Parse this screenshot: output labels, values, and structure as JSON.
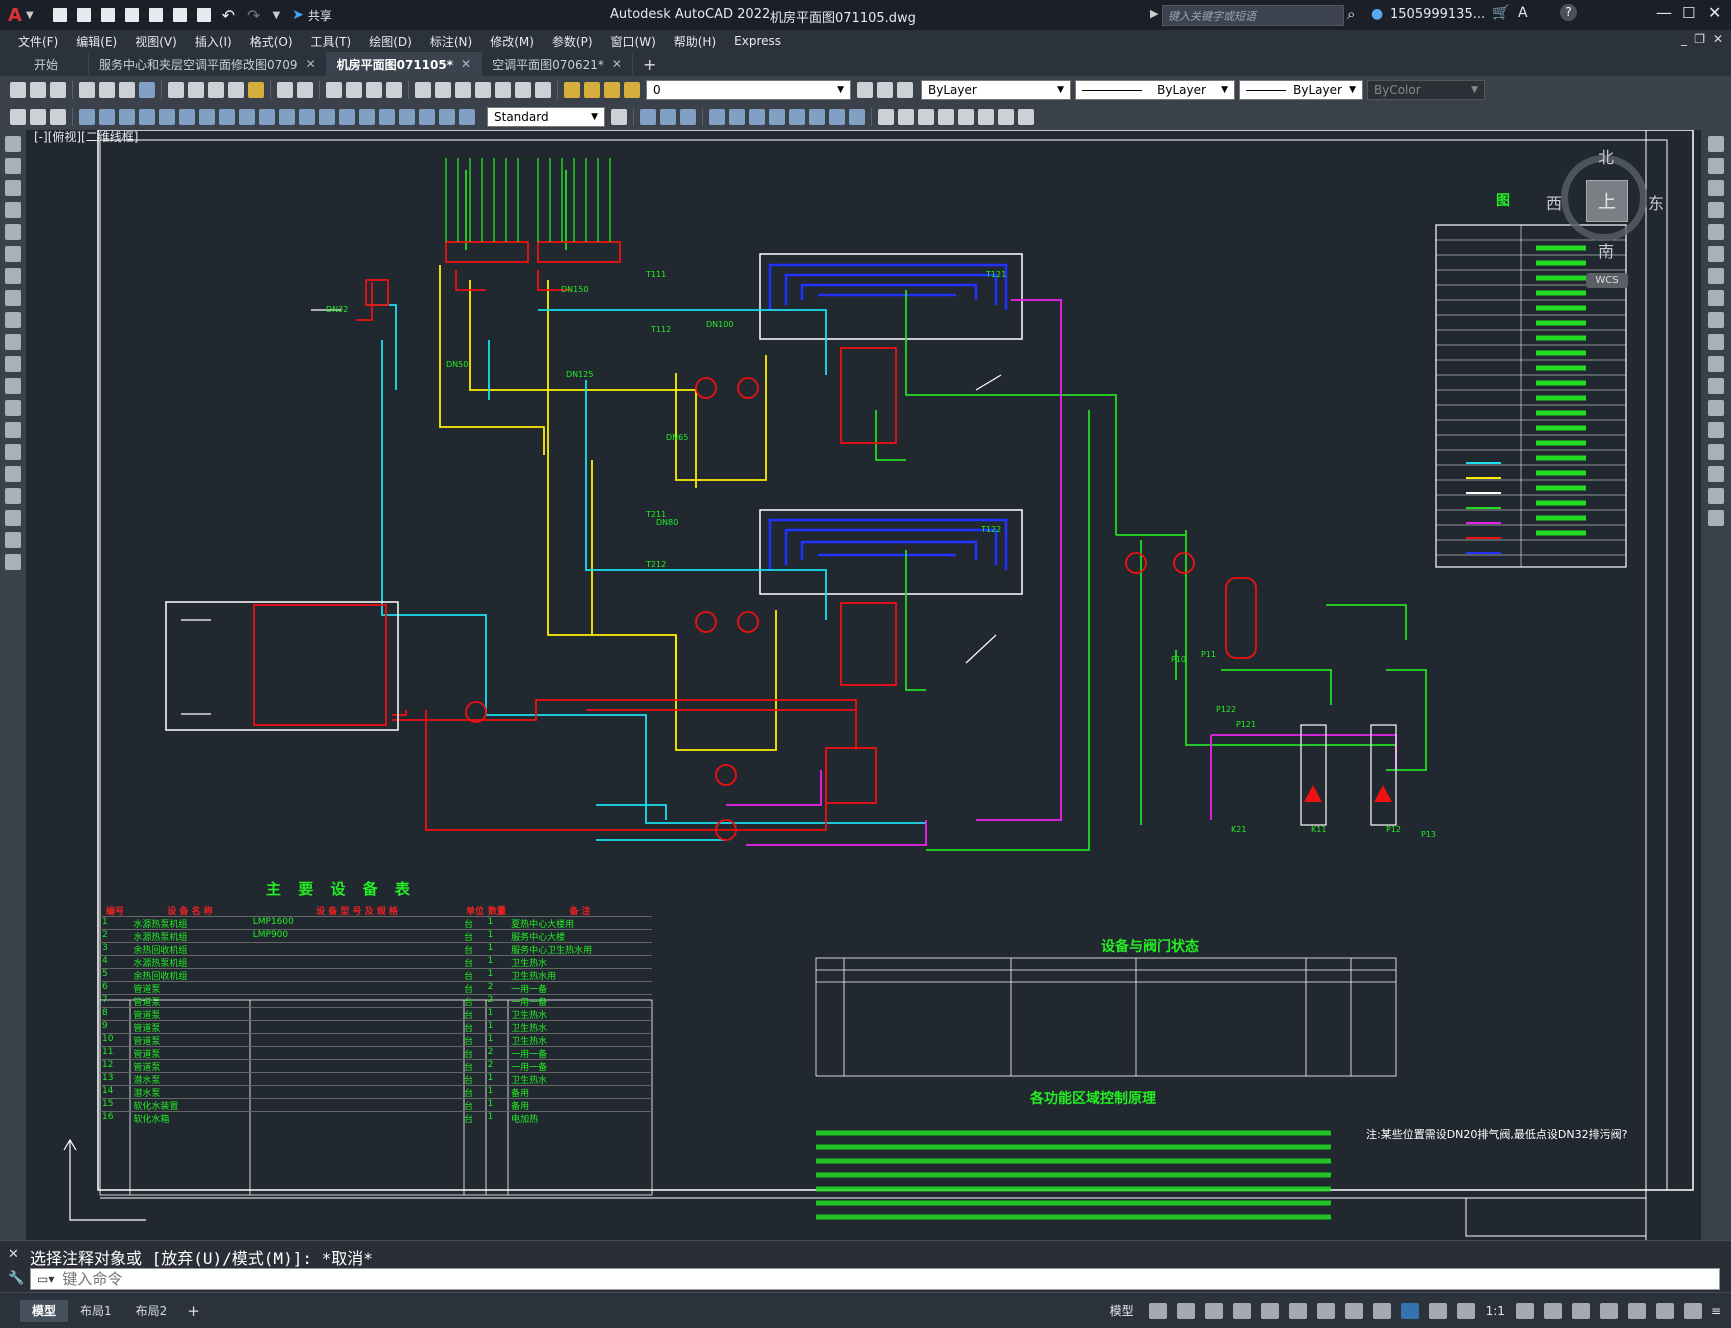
{
  "titlebar": {
    "app_logo": "A",
    "share_label": "共享",
    "app_title": "Autodesk AutoCAD 2022",
    "file_name": "机房平面图071105.dwg",
    "search_placeholder": "键入关键字或短语",
    "user_name": "1505999135..."
  },
  "menu": [
    "文件(F)",
    "编辑(E)",
    "视图(V)",
    "插入(I)",
    "格式(O)",
    "工具(T)",
    "绘图(D)",
    "标注(N)",
    "修改(M)",
    "参数(P)",
    "窗口(W)",
    "帮助(H)",
    "Express"
  ],
  "tabs": [
    {
      "label": "开始",
      "active": false,
      "closable": false
    },
    {
      "label": "服务中心和夹层空调平面修改图0709",
      "active": false,
      "closable": true
    },
    {
      "label": "机房平面图071105*",
      "active": true,
      "closable": true
    },
    {
      "label": "空调平面图070621*",
      "active": false,
      "closable": true
    }
  ],
  "toolbar": {
    "layer_value": "0",
    "color_value": "ByLayer",
    "linetype_value": "ByLayer",
    "lineweight_value": "ByLayer",
    "plotstyle_value": "ByColor",
    "textstyle_value": "Standard"
  },
  "viewport": {
    "label": "[-][俯视][二维线框]",
    "compass_n": "北",
    "compass_s": "南",
    "compass_e": "东",
    "compass_w": "西",
    "cube_top": "上",
    "wcs": "WCS"
  },
  "drawing": {
    "equipment_table_title": "主 要 设 备 表",
    "valve_table_title": "设备与阀门状态",
    "control_title": "各功能区域控制原理",
    "legend_title": "图 例",
    "equipment_headers": [
      "编号",
      "设 备 名 称",
      "设 备 型 号 及 规 格",
      "单位",
      "数量",
      "备 注"
    ],
    "equipment_rows": [
      [
        "1",
        "水源热泵机组",
        "LMP1600",
        "台",
        "1",
        "夏热中心大楼用"
      ],
      [
        "2",
        "水源热泵机组",
        "LMP900",
        "台",
        "1",
        "服务中心大楼"
      ],
      [
        "3",
        "余热回收机组",
        "",
        "台",
        "1",
        "服务中心卫生热水用"
      ],
      [
        "4",
        "水源热泵机组",
        "",
        "台",
        "1",
        "卫生热水"
      ],
      [
        "5",
        "余热回收机组",
        "",
        "台",
        "1",
        "卫生热水用"
      ],
      [
        "6",
        "管道泵",
        "",
        "台",
        "2",
        "一用一备"
      ],
      [
        "7",
        "管道泵",
        "",
        "台",
        "2",
        "一用一备"
      ],
      [
        "8",
        "管道泵",
        "",
        "台",
        "1",
        "卫生热水"
      ],
      [
        "9",
        "管道泵",
        "",
        "台",
        "1",
        "卫生热水"
      ],
      [
        "10",
        "管道泵",
        "",
        "台",
        "1",
        "卫生热水"
      ],
      [
        "11",
        "管道泵",
        "",
        "台",
        "2",
        "一用一备"
      ],
      [
        "12",
        "管道泵",
        "",
        "台",
        "2",
        "一用一备"
      ],
      [
        "13",
        "潜水泵",
        "",
        "台",
        "1",
        "卫生热水"
      ],
      [
        "14",
        "潜水泵",
        "",
        "台",
        "1",
        "备用"
      ],
      [
        "15",
        "软化水装置",
        "",
        "台",
        "1",
        "备用"
      ],
      [
        "16",
        "软化水箱",
        "",
        "台",
        "1",
        "电加热"
      ]
    ],
    "note_text": "注:某些位置需设DN20排气阀,最低点设DN32排污阀?",
    "pipe_labels": [
      "DN150",
      "DN125",
      "DN100",
      "DN80",
      "DN65",
      "DN50",
      "DN32",
      "T111",
      "T112",
      "T211",
      "T212",
      "T121",
      "T122",
      "K11",
      "K21",
      "P13",
      "P12",
      "P121",
      "P122",
      "P10",
      "P11"
    ]
  },
  "command": {
    "history": "选择注释对象或 [放弃(U)/模式(M)]: *取消*",
    "placeholder": "键入命令"
  },
  "statusbar": {
    "layouts": [
      {
        "label": "模型",
        "active": true
      },
      {
        "label": "布局1",
        "active": false
      },
      {
        "label": "布局2",
        "active": false
      }
    ],
    "model_label": "模型",
    "scale": "1:1"
  }
}
